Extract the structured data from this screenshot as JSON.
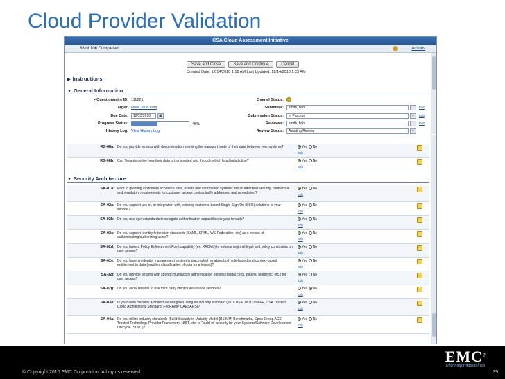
{
  "slide": {
    "title": "Cloud Provider Validation",
    "copyright": "© Copyright 2010 EMC Corporation. All rights reserved.",
    "page_number": "39"
  },
  "logo": {
    "text": "EMC",
    "sup": "2",
    "tagline": "where information lives"
  },
  "app": {
    "window_title": "CSA Cloud Assessment Initiative",
    "completed": "88 of 106 Completed",
    "actions_label": "Actions",
    "buttons": {
      "save_close": "Save and Close",
      "save_continue": "Save and Continue",
      "cancel": "Cancel"
    },
    "created_line": "Created Date: 12/14/2010 1:18 AM   Last Updated: 12/14/2010 1:23 AM"
  },
  "sections": {
    "instructions": "Instructions",
    "general": "General Information",
    "security": "Security Architecture"
  },
  "general_info": {
    "questionnaire_label": "• Questionnaire ID:",
    "questionnaire_value": "111221",
    "target_label": "Target:",
    "target_value": "NewCloud.com",
    "due_label": "Due Date:",
    "due_value": "12/23/2010",
    "progress_label": "Progress Status:",
    "progress_value": "45%",
    "progress_fraction": 0.45,
    "history_label": "History Log:",
    "history_value": "View History Log",
    "overall_label": "Overall Status:",
    "submitter_label": "Submitter:",
    "submitter_value": "smith, bob",
    "submission_label": "Submission Status:",
    "submission_value": "In Process",
    "reviewer_label": "Reviewer:",
    "reviewer_value": "smith, bob",
    "review_label": "Review Status:",
    "review_value": "Awaiting Review",
    "edit": "Edit"
  },
  "answers": {
    "yes": "Yes",
    "no": "No",
    "edit": "Edit"
  },
  "questions_top": [
    {
      "id": "RS-08a:",
      "text": "Do you provide tenants with documentation showing the transport route of their data between your systems?",
      "answer": "yes"
    },
    {
      "id": "RS-08b:",
      "text": "Can Tenants define how their data is transported and through which legal jurisdiction?",
      "answer": "yes"
    }
  ],
  "questions_sec": [
    {
      "id": "SA-01a:",
      "text": "Prior to granting customers access to data, assets and information systems are all identified security, contractual and regulatory requirements for customer access contractually addressed and remediated?",
      "answer": "yes"
    },
    {
      "id": "SA-02a:",
      "text": "Do you support use of, or integration with, existing customer-based Single Sign On (SSO) solutions to your service?",
      "answer": "yes"
    },
    {
      "id": "SA-02b:",
      "text": "Do you use open standards to delegate authentication capabilities to your tenants?",
      "answer": "yes"
    },
    {
      "id": "SA-02c:",
      "text": "Do you support identity federation standards (SAML, SPML, WS-Federation, etc) as a means of authenticating/authorizing users?",
      "answer": "yes"
    },
    {
      "id": "SA-02d:",
      "text": "Do you have a Policy Enforcement Point capability (ex. XACML) to enforce regional legal and policy constraints on user access?",
      "answer": "yes"
    },
    {
      "id": "SA-02e:",
      "text": "Do you have an identity management system in place which enables both role-based and context-based entitlement to data (enables classification of data for a tenant)?",
      "answer": "yes"
    },
    {
      "id": "SA-02f:",
      "text": "Do you provide tenants with strong (multifactor) authentication options (digital certs, tokens, biometric, etc.) for user access?",
      "answer": "yes"
    },
    {
      "id": "SA-02g:",
      "text": "Do you allow tenants to use third party identity assurance services?",
      "answer": "no"
    },
    {
      "id": "SA-03a:",
      "text": "Is your Data Security Architecture designed using an industry standard (ex. CDSA, MULITSAFE, CSA Trusted Cloud Architectural Standard, FedRAMP CAESARS)?",
      "answer": "yes"
    },
    {
      "id": "SA-04a:",
      "text": "Do you utilize industry standards (Build Security in Maturity Model [BSIMM] Benchmarks, Open Group ACS Trusted Technology Provider Framework, NIST, etc) to \"build-in\" security for your Systems/Software Development Lifecycle (SDLC)?",
      "answer": "yes"
    }
  ]
}
